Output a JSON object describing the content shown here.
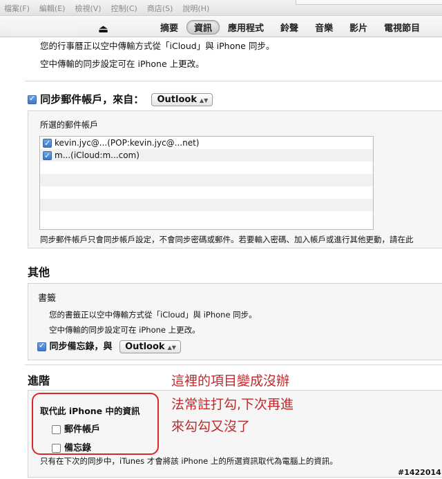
{
  "menu": [
    "檔案(F)",
    "編輯(E)",
    "檢視(V)",
    "控制(C)",
    "商店(S)",
    "說明(H)"
  ],
  "device": {
    "name": ""
  },
  "tabs": [
    {
      "label": "摘要",
      "active": false
    },
    {
      "label": "資訊",
      "active": true
    },
    {
      "label": "應用程式",
      "active": false
    },
    {
      "label": "鈴聲",
      "active": false
    },
    {
      "label": "音樂",
      "active": false
    },
    {
      "label": "影片",
      "active": false
    },
    {
      "label": "電視節目",
      "active": false
    }
  ],
  "calendar_note": {
    "line1": "您的行事曆正以空中傳輸方式從「iCloud」與 iPhone 同步。",
    "line2": "空中傳輸的同步設定可在 iPhone 上更改。"
  },
  "mail": {
    "sync_label": "同步郵件帳戶，來自：",
    "sync_checked": true,
    "source": "Outlook",
    "accounts_title": "所選的郵件帳戶",
    "accounts": [
      {
        "text": "kevin.jyc@...(POP:kevin.jyc@...net)",
        "checked": true
      },
      {
        "text": "m...(iCloud:m...com)",
        "checked": true
      }
    ],
    "note": "同步郵件帳戶只會同步帳戶設定，不會同步密碼或郵件。若要輸入密碼、加入帳戶或進行其他更動，請在此"
  },
  "other": {
    "title": "其他",
    "bookmarks_title": "書籤",
    "line1": "您的書籤正以空中傳輸方式從「iCloud」與 iPhone 同步。",
    "line2": "空中傳輸的同步設定可在 iPhone 上更改。",
    "notes_label": "同步備忘錄，與",
    "notes_checked": true,
    "notes_source": "Outlook"
  },
  "advanced": {
    "title": "進階",
    "replace_title": "取代此 iPhone 中的資訊",
    "options": [
      {
        "label": "郵件帳戶",
        "checked": false
      },
      {
        "label": "備忘錄",
        "checked": false
      }
    ],
    "note": "只有在下次的同步中，iTunes 才會將該 iPhone 上的所選資訊取代為電腦上的資訊。"
  },
  "annotation": {
    "line1": "這裡的項目變成沒辦",
    "line2": "法常註打勾,下次再進",
    "line3": "來勾勾又沒了"
  },
  "watermark": "#1422014",
  "colors": {
    "annotation_red": "#d9262b",
    "checkbox_blue": "#3c78c9"
  }
}
